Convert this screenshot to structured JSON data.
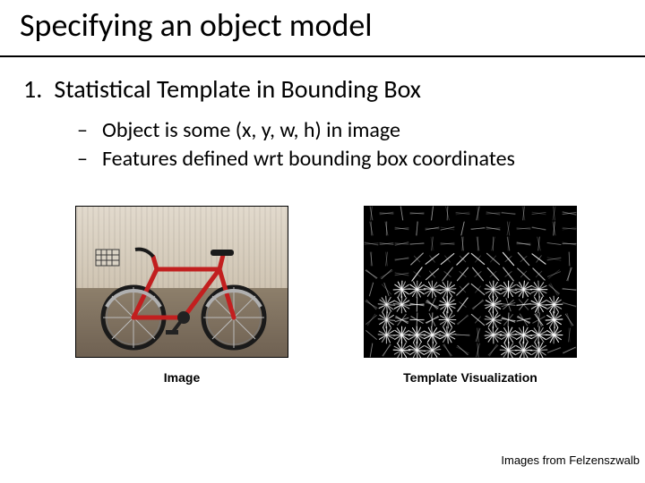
{
  "title": "Specifying an object model",
  "list_number": "1.",
  "list_text": "Statistical Template in Bounding Box",
  "sub_dash": "–",
  "sub_items": [
    "Object is some (x, y, w, h) in image",
    "Features defined wrt bounding box coordinates"
  ],
  "captions": {
    "left": "Image",
    "right": "Template Visualization"
  },
  "credit": "Images from Felzenszwalb"
}
